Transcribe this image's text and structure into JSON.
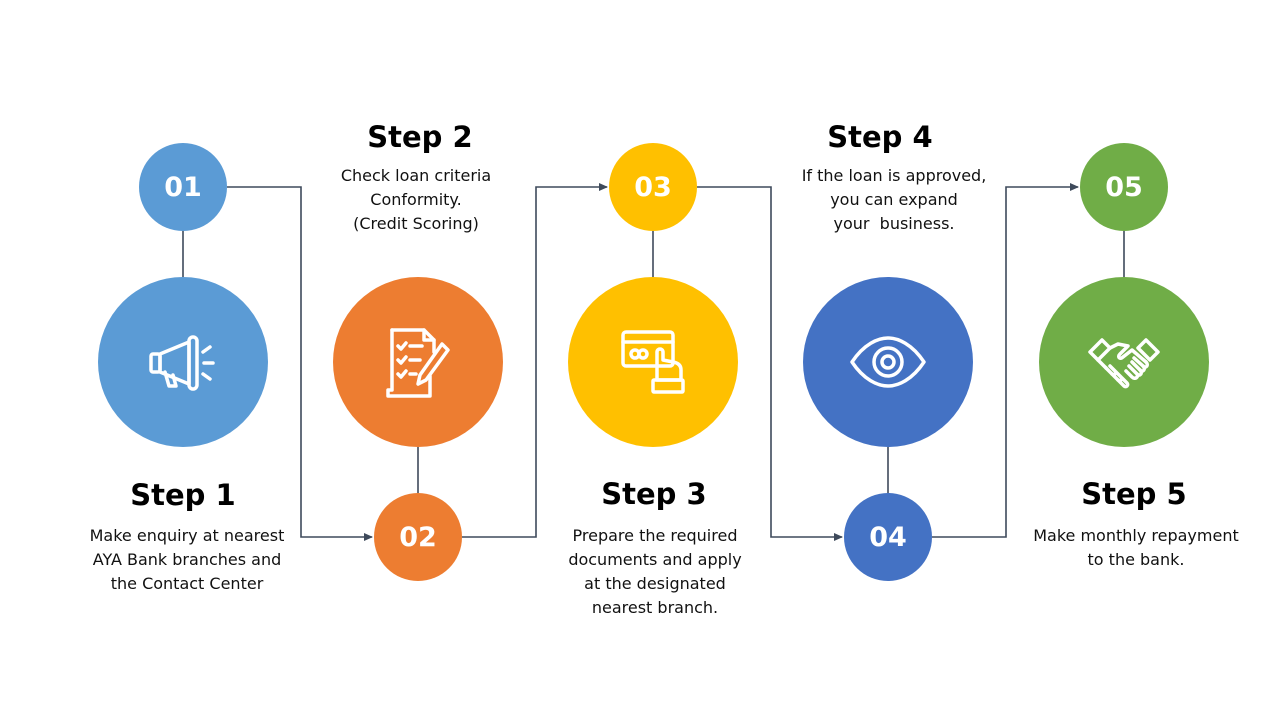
{
  "colors": {
    "step1": "#5B9BD5",
    "step2": "#ED7D31",
    "step3": "#FFC000",
    "step4": "#4472C4",
    "step5": "#70AD47",
    "connector": "#3E4A5B"
  },
  "steps": [
    {
      "number": "01",
      "title": "Step 1",
      "icon": "megaphone-icon",
      "lines": [
        "Make enquiry at nearest",
        "AYA Bank branches and",
        "the Contact Center"
      ]
    },
    {
      "number": "02",
      "title": "Step 2",
      "icon": "checklist-document-icon",
      "lines": [
        "Check loan criteria",
        "Conformity.",
        "(Credit Scoring)"
      ]
    },
    {
      "number": "03",
      "title": "Step 3",
      "icon": "hand-holding-card-icon",
      "lines": [
        "Prepare the required",
        "documents and apply",
        "at the designated",
        "nearest branch."
      ]
    },
    {
      "number": "04",
      "title": "Step 4",
      "icon": "eye-icon",
      "lines": [
        "If the loan is approved,",
        "you can expand",
        "your  business."
      ]
    },
    {
      "number": "05",
      "title": "Step 5",
      "icon": "handshake-icon",
      "lines": [
        "Make monthly repayment",
        "to the bank."
      ]
    }
  ]
}
